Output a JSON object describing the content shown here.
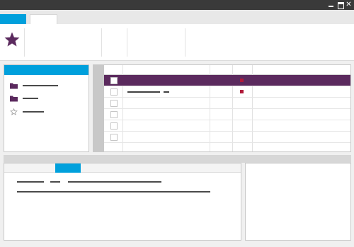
{
  "titlebar": {
    "icons": [
      "minimize-icon",
      "maximize-icon",
      "close-icon"
    ],
    "close_glyph": "✕"
  },
  "ribbon": {
    "icons": [
      "star-icon"
    ]
  },
  "grid": {
    "selected_row_text": "",
    "status_color": "#b01a3a"
  },
  "colors": {
    "accent": "#00a0dc",
    "selection": "#5b2a5e",
    "icon_purple": "#5b2a5e",
    "titlebar": "#3a3a3a"
  },
  "tree": {
    "icons": [
      "folder-icon",
      "folder-icon",
      "star-outline-icon"
    ]
  }
}
